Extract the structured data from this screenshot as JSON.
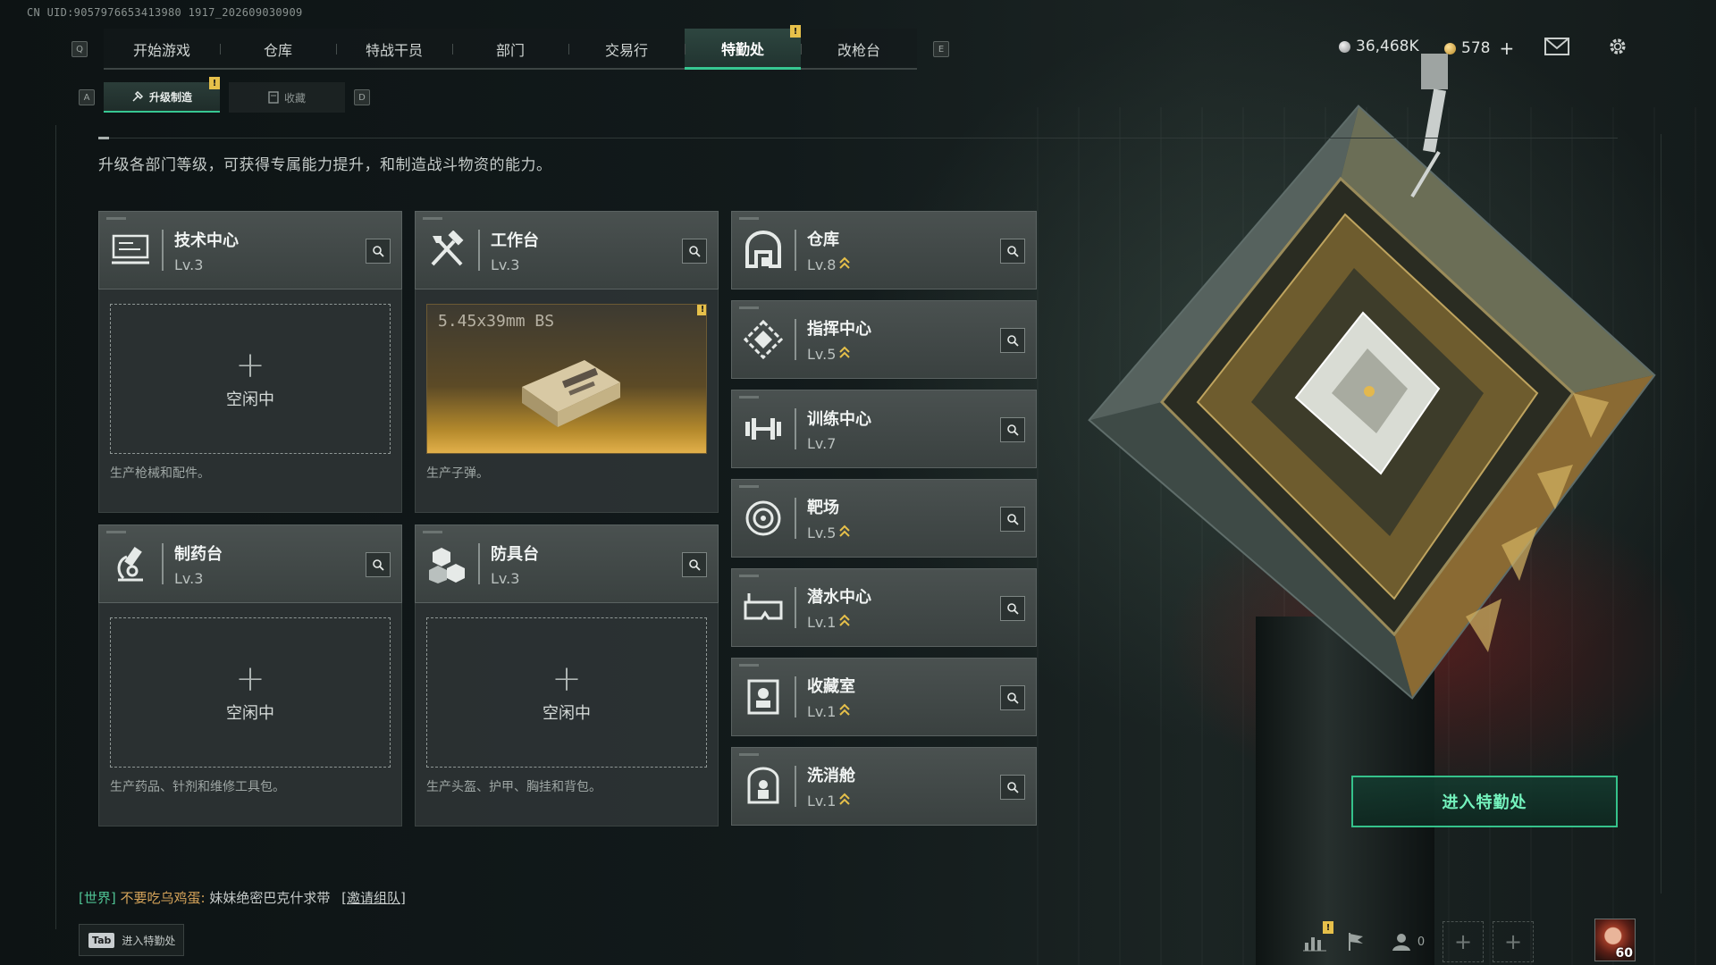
{
  "uid": "CN UID:9057976653413980 1917_202609030909",
  "nav": {
    "key_left": "Q",
    "key_right": "E",
    "tabs": [
      {
        "label": "开始游戏",
        "active": false
      },
      {
        "label": "仓库",
        "active": false
      },
      {
        "label": "特战干员",
        "active": false
      },
      {
        "label": "部门",
        "active": false
      },
      {
        "label": "交易行",
        "active": false
      },
      {
        "label": "特勤处",
        "active": true,
        "badge": "!"
      },
      {
        "label": "改枪台",
        "active": false
      }
    ]
  },
  "currency": {
    "silver": "36,468K",
    "gold": "578",
    "add": "+"
  },
  "subnav": {
    "key_left": "A",
    "key_right": "D",
    "tabs": [
      {
        "label": "升级制造",
        "active": true,
        "badge": "!"
      },
      {
        "label": "收藏",
        "active": false
      }
    ]
  },
  "description": "升级各部门等级，可获得专属能力提升，和制造战斗物资的能力。",
  "production": [
    {
      "name": "技术中心",
      "level": "Lv.3",
      "icon": "tech-center-icon",
      "state": "idle",
      "slot_plus": "+",
      "slot_text": "空闲中",
      "produce": "生产枪械和配件。"
    },
    {
      "name": "工作台",
      "level": "Lv.3",
      "icon": "workbench-icon",
      "state": "producing",
      "item": "5.45x39mm BS",
      "badge": "!",
      "produce": "生产子弹。"
    },
    {
      "name": "制药台",
      "level": "Lv.3",
      "icon": "pharmacy-icon",
      "state": "idle",
      "slot_plus": "+",
      "slot_text": "空闲中",
      "produce": "生产药品、针剂和维修工具包。"
    },
    {
      "name": "防具台",
      "level": "Lv.3",
      "icon": "armor-bench-icon",
      "state": "idle",
      "slot_plus": "+",
      "slot_text": "空闲中",
      "produce": "生产头盔、护甲、胸挂和背包。"
    }
  ],
  "facilities": [
    {
      "name": "仓库",
      "level": "Lv.8",
      "upgradable": true,
      "icon": "warehouse-icon"
    },
    {
      "name": "指挥中心",
      "level": "Lv.5",
      "upgradable": true,
      "icon": "command-center-icon"
    },
    {
      "name": "训练中心",
      "level": "Lv.7",
      "upgradable": false,
      "icon": "training-center-icon"
    },
    {
      "name": "靶场",
      "level": "Lv.5",
      "upgradable": true,
      "icon": "shooting-range-icon"
    },
    {
      "name": "潜水中心",
      "level": "Lv.1",
      "upgradable": true,
      "icon": "diving-center-icon"
    },
    {
      "name": "收藏室",
      "level": "Lv.1",
      "upgradable": true,
      "icon": "collection-room-icon"
    },
    {
      "name": "洗消舱",
      "level": "Lv.1",
      "upgradable": true,
      "icon": "decon-chamber-icon"
    }
  ],
  "enter_button": "进入特勤处",
  "chat": {
    "channel": "[世界]",
    "user": "不要吃乌鸡蛋:",
    "message": "妹妹绝密巴克什求带",
    "invite": "[邀请组队]"
  },
  "tab_hint": {
    "key": "Tab",
    "label": "进入特勤处"
  },
  "bottom_bar": {
    "friends_count": "0",
    "player_level": "60",
    "stats_badge": "!"
  },
  "colors": {
    "accent": "#37c792",
    "upgrade_arrow": "#e6c04a",
    "badge": "#e6c04a"
  }
}
